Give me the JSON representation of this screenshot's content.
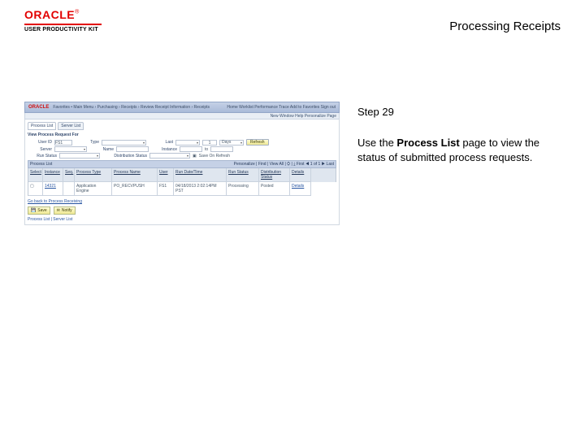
{
  "banner": {
    "brand": "ORACLE",
    "sub": "USER PRODUCTIVITY KIT",
    "title": "Processing Receipts"
  },
  "panel": {
    "step": "Step 29",
    "desc_pre": "Use the ",
    "desc_bold": "Process List",
    "desc_post": " page to view the status of submitted process requests."
  },
  "mini": {
    "brand": "ORACLE",
    "nav": [
      "Favorites",
      "Main Menu",
      "Purchasing",
      "Receipts",
      "Review Receipt Information",
      "Receipts"
    ],
    "topLinks": "Home   Worklist   Performance Trace   Add to Favorites   Sign out",
    "subbar": "New Window   Help   Personalize Page",
    "tabs": {
      "a": "Process List",
      "b": "Server List"
    },
    "section": "View Process Request For",
    "form": {
      "userLbl": "User ID",
      "userVal": "FS1",
      "typeLbl": "Type",
      "lastLbl": "Last",
      "lastVal": "1",
      "daysVal": "Days",
      "refresh": "Refresh",
      "serverLbl": "Server",
      "nameLbl": "Name",
      "instLbl": "Instance",
      "toLbl": "to",
      "runLbl": "Run Status",
      "distLbl": "Distribution Status",
      "saveChk": "Save On Refresh"
    },
    "grid": {
      "title": "Process List",
      "count": "1-1 of 1",
      "tools": "Personalize | Find | View All | ⛭ | ⤓  First ◀ 1 of 1 ▶ Last",
      "h": [
        "Select",
        "Instance",
        "Seq.",
        "Process Type",
        "Process Name",
        "User",
        "Run Date/Time",
        "Run Status",
        "Distribution Status",
        "Details"
      ],
      "row": {
        "inst": "14321",
        "ptype": "Application Engine",
        "pname": "PO_RECVPUSH",
        "user": "FS1",
        "dt": "04/18/2013 2:02:14PM PST",
        "rs": "Processing",
        "ds": "Posted",
        "det": "Details"
      }
    },
    "sched": "Go back to Process Receiving",
    "save": "Save",
    "notify": "Notify",
    "footlink": "Process List | Server List"
  }
}
